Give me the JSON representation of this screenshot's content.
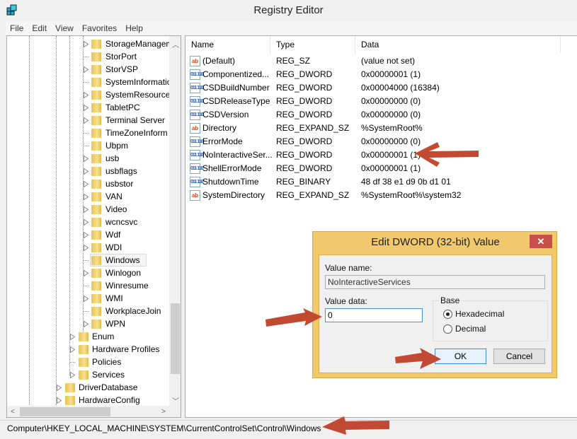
{
  "window": {
    "title": "Registry Editor"
  },
  "menu": [
    "File",
    "Edit",
    "View",
    "Favorites",
    "Help"
  ],
  "tree": [
    {
      "label": "StorageManagem",
      "level": 4,
      "expandable": true
    },
    {
      "label": "StorPort",
      "level": 4,
      "expandable": false
    },
    {
      "label": "StorVSP",
      "level": 4,
      "expandable": true
    },
    {
      "label": "SystemInformatio",
      "level": 4,
      "expandable": false
    },
    {
      "label": "SystemResources",
      "level": 4,
      "expandable": true
    },
    {
      "label": "TabletPC",
      "level": 4,
      "expandable": true
    },
    {
      "label": "Terminal Server",
      "level": 4,
      "expandable": true
    },
    {
      "label": "TimeZoneInform",
      "level": 4,
      "expandable": false
    },
    {
      "label": "Ubpm",
      "level": 4,
      "expandable": false
    },
    {
      "label": "usb",
      "level": 4,
      "expandable": true
    },
    {
      "label": "usbflags",
      "level": 4,
      "expandable": true
    },
    {
      "label": "usbstor",
      "level": 4,
      "expandable": true
    },
    {
      "label": "VAN",
      "level": 4,
      "expandable": true
    },
    {
      "label": "Video",
      "level": 4,
      "expandable": true
    },
    {
      "label": "wcncsvc",
      "level": 4,
      "expandable": true
    },
    {
      "label": "Wdf",
      "level": 4,
      "expandable": true
    },
    {
      "label": "WDI",
      "level": 4,
      "expandable": true
    },
    {
      "label": "Windows",
      "level": 4,
      "expandable": false,
      "selected": true
    },
    {
      "label": "Winlogon",
      "level": 4,
      "expandable": true
    },
    {
      "label": "Winresume",
      "level": 4,
      "expandable": false
    },
    {
      "label": "WMI",
      "level": 4,
      "expandable": true
    },
    {
      "label": "WorkplaceJoin",
      "level": 4,
      "expandable": false
    },
    {
      "label": "WPN",
      "level": 4,
      "expandable": true
    },
    {
      "label": "Enum",
      "level": 3,
      "expandable": true
    },
    {
      "label": "Hardware Profiles",
      "level": 3,
      "expandable": true
    },
    {
      "label": "Policies",
      "level": 3,
      "expandable": false
    },
    {
      "label": "Services",
      "level": 3,
      "expandable": true
    },
    {
      "label": "DriverDatabase",
      "level": 2,
      "expandable": true
    },
    {
      "label": "HardwareConfig",
      "level": 2,
      "expandable": true
    }
  ],
  "list": {
    "columns": [
      "Name",
      "Type",
      "Data"
    ],
    "rows": [
      {
        "icon": "string",
        "name": "(Default)",
        "type": "REG_SZ",
        "data": "(value not set)"
      },
      {
        "icon": "binary",
        "name": "Componentized...",
        "type": "REG_DWORD",
        "data": "0x00000001 (1)"
      },
      {
        "icon": "binary",
        "name": "CSDBuildNumber",
        "type": "REG_DWORD",
        "data": "0x00004000 (16384)"
      },
      {
        "icon": "binary",
        "name": "CSDReleaseType",
        "type": "REG_DWORD",
        "data": "0x00000000 (0)"
      },
      {
        "icon": "binary",
        "name": "CSDVersion",
        "type": "REG_DWORD",
        "data": "0x00000000 (0)"
      },
      {
        "icon": "string",
        "name": "Directory",
        "type": "REG_EXPAND_SZ",
        "data": "%SystemRoot%"
      },
      {
        "icon": "binary",
        "name": "ErrorMode",
        "type": "REG_DWORD",
        "data": "0x00000000 (0)"
      },
      {
        "icon": "binary",
        "name": "NoInteractiveSer...",
        "type": "REG_DWORD",
        "data": "0x00000001 (1)"
      },
      {
        "icon": "binary",
        "name": "ShellErrorMode",
        "type": "REG_DWORD",
        "data": "0x00000001 (1)"
      },
      {
        "icon": "binary",
        "name": "ShutdownTime",
        "type": "REG_BINARY",
        "data": "48 df 38 e1 d9 0b d1 01"
      },
      {
        "icon": "string",
        "name": "SystemDirectory",
        "type": "REG_EXPAND_SZ",
        "data": "%SystemRoot%\\system32"
      }
    ]
  },
  "icons": {
    "string": "ab",
    "binary": "011 110"
  },
  "status": "Computer\\HKEY_LOCAL_MACHINE\\SYSTEM\\CurrentControlSet\\Control\\Windows",
  "dialog": {
    "title": "Edit DWORD (32-bit) Value",
    "close": "✕",
    "value_name_label": "Value name:",
    "value_name": "NoInteractiveServices",
    "value_data_label": "Value data:",
    "value_data": "0",
    "base_label": "Base",
    "base_options": [
      {
        "label": "Hexadecimal",
        "checked": true
      },
      {
        "label": "Decimal",
        "checked": false
      }
    ],
    "ok": "OK",
    "cancel": "Cancel"
  },
  "colors": {
    "annotation_arrow": "#c24a32",
    "dialog_frame": "#f1c86b",
    "close_button": "#c7504a"
  }
}
